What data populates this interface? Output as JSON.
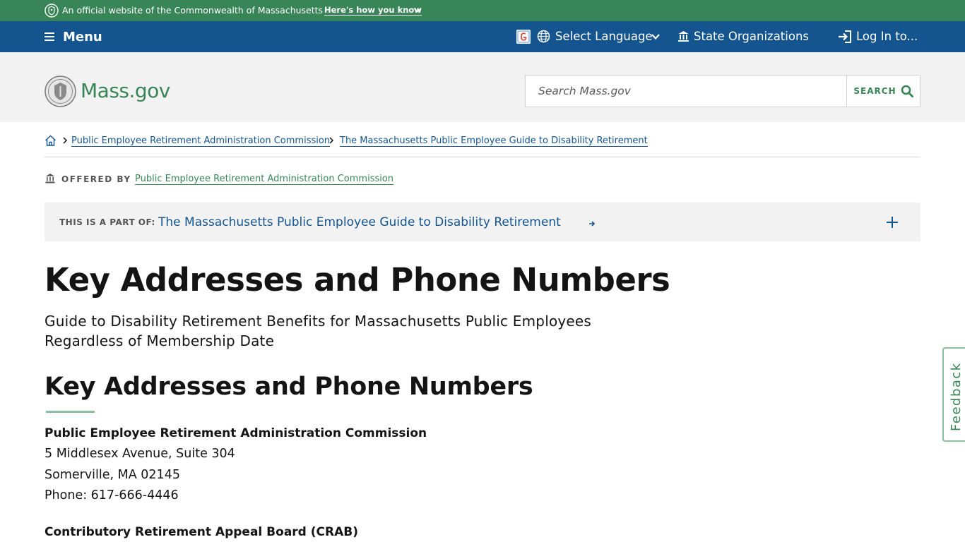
{
  "official_banner": {
    "text": "An official website of the Commonwealth of Massachusetts",
    "link": "Here's how you know"
  },
  "utility_nav": {
    "menu_label": "Menu",
    "language_label": "Select Language",
    "orgs_label": "State Organizations",
    "login_label": "Log In to..."
  },
  "header": {
    "logo_text": "Mass.gov",
    "search_placeholder": "Search Mass.gov",
    "search_button": "SEARCH"
  },
  "breadcrumb": {
    "items": [
      "Public Employee Retirement Administration Commission",
      "The Massachusetts Public Employee Guide to Disability Retirement"
    ]
  },
  "offered_by": {
    "label": "OFFERED BY",
    "org": "Public Employee Retirement Administration Commission"
  },
  "part_of": {
    "label": "THIS IS A PART OF:",
    "link": "The Massachusetts Public Employee Guide to Disability Retirement"
  },
  "page": {
    "title": "Key Addresses and Phone Numbers",
    "subtitle": "Guide to Disability Retirement Benefits for Massachusetts Public Employees Regardless of Membership Date",
    "section_title": "Key Addresses and Phone Numbers"
  },
  "addresses": [
    {
      "name": "Public Employee Retirement Administration Commission",
      "line1": "5 Middlesex Avenue, Suite 304",
      "line2": "Somerville, MA 02145",
      "phone": "Phone: 617-666-4446"
    },
    {
      "name": "Contributory Retirement Appeal Board (CRAB)"
    }
  ],
  "feedback": {
    "label": "Feedback"
  },
  "colors": {
    "green": "#388557",
    "blue": "#14558f",
    "header_bg": "#f2f2f2"
  }
}
